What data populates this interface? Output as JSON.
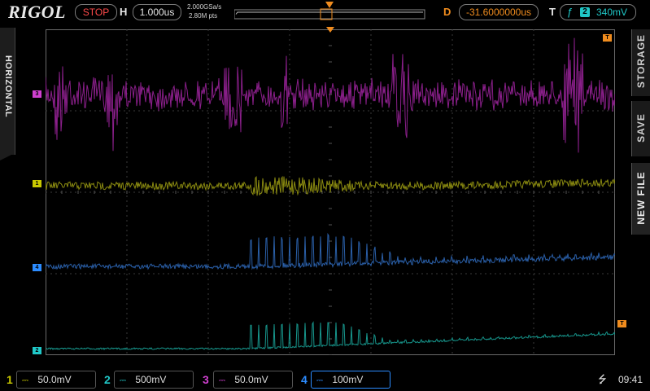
{
  "brand": "RIGOL",
  "top": {
    "run_state": "STOP",
    "horizontal_label": "H",
    "timebase": "1.000us",
    "sample_rate": "2.000GSa/s",
    "memory_depth": "2.80M pts",
    "delay_label": "D",
    "delay_value": "-31.6000000us",
    "trigger_label": "T",
    "trigger_source": "2",
    "trigger_level": "340mV"
  },
  "side": {
    "left_tab": "HORIZONTAL",
    "right_tabs": [
      "STORAGE",
      "SAVE",
      "NEW FILE"
    ]
  },
  "channels": [
    {
      "id": "1",
      "scale": "50.0mV",
      "color": "#c8c800",
      "trace_color": "#8a8a10",
      "active": false
    },
    {
      "id": "2",
      "scale": "500mV",
      "color": "#20c8c8",
      "trace_color": "#17968c",
      "active": false
    },
    {
      "id": "3",
      "scale": "50.0mV",
      "color": "#d040d0",
      "trace_color": "#8a1f8a",
      "active": false
    },
    {
      "id": "4",
      "scale": "100mV",
      "color": "#2c8cff",
      "trace_color": "#2a5fa8",
      "active": true
    }
  ],
  "markers": {
    "trigger_level_marker": "T",
    "top_right_marker": "T"
  },
  "status": {
    "usb_icon": "usb-icon",
    "time": "09:41"
  },
  "colors": {
    "accent_orange": "#f08c1e",
    "grid": "#3a3a3a",
    "frame": "#6a6a6a"
  }
}
